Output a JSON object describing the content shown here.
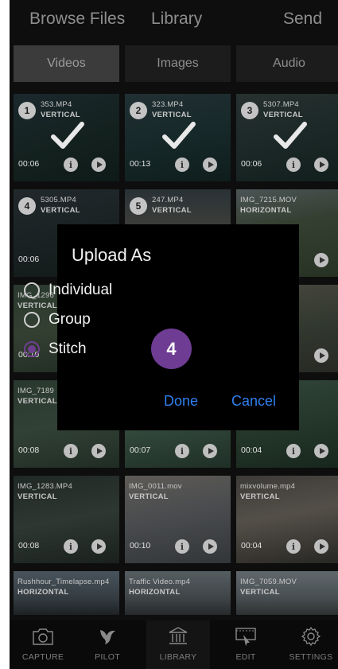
{
  "header": {
    "browse_files": "Browse Files",
    "library": "Library",
    "send": "Send"
  },
  "media_tabs": [
    {
      "label": "Videos",
      "active": true
    },
    {
      "label": "Images",
      "active": false
    },
    {
      "label": "Audio",
      "active": false
    }
  ],
  "tiles": [
    {
      "name": "353.MP4",
      "orientation": "VERTICAL",
      "duration": "00:06",
      "number": "1",
      "selected": true,
      "bg": "linear-gradient(160deg,#3c5a66 0%,#2c4a44 55%,#1f3a35 100%)"
    },
    {
      "name": "323.MP4",
      "orientation": "VERTICAL",
      "duration": "00:13",
      "number": "2",
      "selected": true,
      "bg": "linear-gradient(170deg,#4a6a70 0%,#335a5c 50%,#22423f 100%)"
    },
    {
      "name": "5307.MP4",
      "orientation": "VERTICAL",
      "duration": "00:06",
      "number": "3",
      "selected": true,
      "bg": "linear-gradient(165deg,#566d6a 0%,#3e5a57 50%,#274440 100%)"
    },
    {
      "name": "5305.MP4",
      "orientation": "VERTICAL",
      "duration": "00:06",
      "number": "4",
      "selected": true,
      "bg": "linear-gradient(170deg,#4b5a63 0%,#3a4c4f 50%,#2b3a38 100%)"
    },
    {
      "name": "247.MP4",
      "orientation": "VERTICAL",
      "duration": "",
      "number": "5",
      "selected": true,
      "bg": "linear-gradient(180deg,#5c6e78 0%,#8a8a80 45%,#4e5a4a 100%)"
    },
    {
      "name": "IMG_7215.MOV",
      "orientation": "HORIZONTAL",
      "duration": "",
      "number": "",
      "selected": false,
      "bg": "linear-gradient(170deg,#6f7c7e 0%,#4e5e49 40%,#3a4a35 100%)"
    },
    {
      "name": "IMG_1296",
      "orientation": "VERTICAL",
      "duration": "00:10",
      "number": "",
      "selected": false,
      "bg": "linear-gradient(170deg,#3f5548 0%,#4c5e49 50%,#2e3f33 100%)"
    },
    {
      "name": "",
      "orientation": "",
      "duration": "",
      "number": "",
      "selected": false,
      "bg": "linear-gradient(170deg,#3c4a40 0%,#2b362f 100%)"
    },
    {
      "name": "",
      "orientation": "",
      "duration": "",
      "number": "",
      "selected": false,
      "bg": "linear-gradient(170deg,#6b6a5c 0%,#4b5446 50%,#3a3e35 100%)"
    },
    {
      "name": "IMG_7189",
      "orientation": "VERTICAL",
      "duration": "00:08",
      "number": "",
      "selected": false,
      "bg": "linear-gradient(170deg,#3e5446 0%,#4a6050 50%,#2f4236 100%)"
    },
    {
      "name": "",
      "orientation": "",
      "duration": "00:07",
      "number": "",
      "selected": false,
      "bg": "linear-gradient(170deg,#3d5a4e 0%,#4b6a58 50%,#2d463a 100%)"
    },
    {
      "name": "",
      "orientation": "",
      "duration": "00:04",
      "number": "",
      "selected": false,
      "bg": "linear-gradient(170deg,#4a6656 0%,#37523f 50%,#243a2d 100%)"
    },
    {
      "name": "IMG_1283.MP4",
      "orientation": "VERTICAL",
      "duration": "00:08",
      "number": "",
      "selected": false,
      "bg": "linear-gradient(170deg,#2f3c36 0%,#44524a 50%,#27312c 100%)"
    },
    {
      "name": "IMG_0011.mov",
      "orientation": "VERTICAL",
      "duration": "00:10",
      "number": "",
      "selected": false,
      "bg": "linear-gradient(170deg,#8a8680 0%,#6d7074 45%,#4b4f52 100%)"
    },
    {
      "name": "mixvolume.mp4",
      "orientation": "VERTICAL",
      "duration": "00:04",
      "number": "",
      "selected": false,
      "bg": "linear-gradient(170deg,#5a5753 0%,#7b756b 45%,#3b3935 100%)"
    },
    {
      "name": "Rushhour_Timelapse.mp4",
      "orientation": "HORIZONTAL",
      "duration": "",
      "number": "",
      "selected": false,
      "bg": "linear-gradient(180deg,#6c7c88 0%,#4e5a62 60%,#2c3236 100%)"
    },
    {
      "name": "Traffic Video.mp4",
      "orientation": "HORIZONTAL",
      "duration": "",
      "number": "",
      "selected": false,
      "bg": "linear-gradient(180deg,#7e8a90 0%,#5e666a 60%,#3a3e40 100%)"
    },
    {
      "name": "IMG_7059.MOV",
      "orientation": "VERTICAL",
      "duration": "",
      "number": "",
      "selected": false,
      "bg": "linear-gradient(180deg,#8e9aa0 0%,#6a7478 60%,#45494a 100%)"
    }
  ],
  "dialog": {
    "title": "Upload As",
    "options": [
      {
        "label": "Individual",
        "selected": false
      },
      {
        "label": "Group",
        "selected": false
      },
      {
        "label": "Stitch",
        "selected": true
      }
    ],
    "step_badge": "4",
    "done": "Done",
    "cancel": "Cancel"
  },
  "tabbar": [
    {
      "label": "CAPTURE",
      "icon": "camera-icon",
      "active": false
    },
    {
      "label": "PILOT",
      "icon": "pilot-bird-icon",
      "active": false
    },
    {
      "label": "LIBRARY",
      "icon": "library-icon",
      "active": true
    },
    {
      "label": "EDIT",
      "icon": "edit-film-icon",
      "active": false
    },
    {
      "label": "SETTINGS",
      "icon": "gear-icon",
      "active": false
    }
  ],
  "colors": {
    "accent_purple": "#6e3c93",
    "link_blue": "#2f7ff0",
    "background": "#0e0e0e"
  }
}
